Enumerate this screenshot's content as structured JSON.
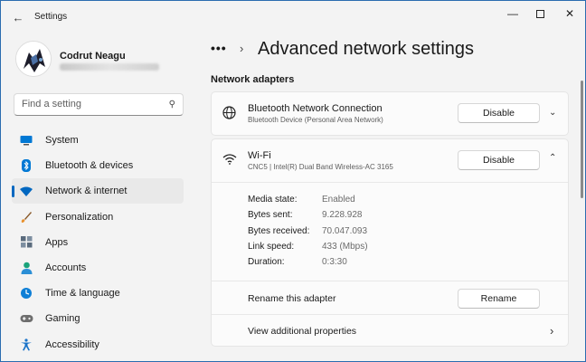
{
  "window": {
    "title": "Settings"
  },
  "user": {
    "name": "Codrut Neagu"
  },
  "search": {
    "placeholder": "Find a setting"
  },
  "sidebar": {
    "items": [
      {
        "label": "System",
        "icon": "monitor-icon",
        "color": "#0078d4"
      },
      {
        "label": "Bluetooth & devices",
        "icon": "bluetooth-icon",
        "color": "#0078d4"
      },
      {
        "label": "Network & internet",
        "icon": "wifi-icon",
        "color": "#0067c0",
        "active": true
      },
      {
        "label": "Personalization",
        "icon": "brush-icon",
        "color": "#e8912d"
      },
      {
        "label": "Apps",
        "icon": "apps-icon",
        "color": "#5a6b7d"
      },
      {
        "label": "Accounts",
        "icon": "person-icon",
        "color": "#1aa37a"
      },
      {
        "label": "Time & language",
        "icon": "globe-clock-icon",
        "color": "#0e7fd6"
      },
      {
        "label": "Gaming",
        "icon": "gamepad-icon",
        "color": "#6e6e6e"
      },
      {
        "label": "Accessibility",
        "icon": "accessibility-icon",
        "color": "#1a73c8"
      }
    ]
  },
  "header": {
    "breadcrumb_dots": "•••",
    "title": "Advanced network settings"
  },
  "section": {
    "title": "Network adapters"
  },
  "adapters": {
    "bluetooth": {
      "title": "Bluetooth Network Connection",
      "subtitle": "Bluetooth Device (Personal Area Network)",
      "button": "Disable"
    },
    "wifi": {
      "title": "Wi-Fi",
      "subtitle": "CNC5 | Intel(R) Dual Band Wireless-AC 3165",
      "button": "Disable",
      "properties": [
        {
          "label": "Media state:",
          "value": "Enabled"
        },
        {
          "label": "Bytes sent:",
          "value": "9.228.928"
        },
        {
          "label": "Bytes received:",
          "value": "70.047.093"
        },
        {
          "label": "Link speed:",
          "value": "433 (Mbps)"
        },
        {
          "label": "Duration:",
          "value": "0:3:30"
        }
      ],
      "rename_label": "Rename this adapter",
      "rename_button": "Rename",
      "view_props_label": "View additional properties"
    }
  },
  "colors": {
    "accent": "#0067c0"
  }
}
